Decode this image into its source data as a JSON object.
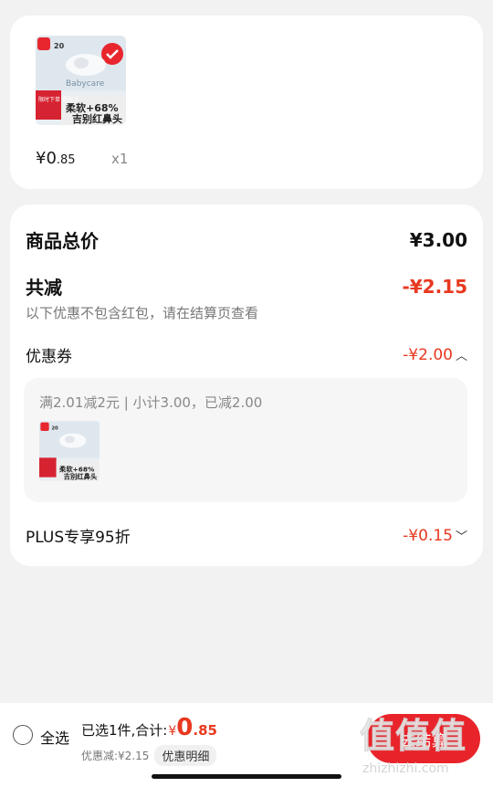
{
  "product": {
    "image_text": {
      "brand": "Babycare",
      "count": "20",
      "promo": "限时下单 送闲 3",
      "slogan_1": "柔软+68%",
      "slogan_2": "吉别红鼻头"
    },
    "price_symbol": "¥",
    "price_int": "0",
    "price_dec": ".85",
    "quantity": "x1"
  },
  "summary": {
    "total_label": "商品总价",
    "total_value": "¥3.00",
    "reduce_label": "共减",
    "reduce_value": "-¥2.15",
    "note": "以下优惠不包含红包，请在结算页查看",
    "coupon_label": "优惠券",
    "coupon_value": "-¥2.00",
    "coupon_detail": "满2.01减2元 | 小计3.00，已减2.00",
    "plus_label": "PLUS专享95折",
    "plus_value": "-¥0.15"
  },
  "bottom_bar": {
    "select_all": "全选",
    "selected_summary": "已选1件,合计:",
    "total_symbol": "¥",
    "total_int": "0",
    "total_dec": ".85",
    "discount_text": "优惠减:¥2.15",
    "detail_button": "优惠明细",
    "checkout_button": "去结算"
  },
  "watermark": {
    "text": "值值值",
    "url": "zhizhizhi.com"
  },
  "colors": {
    "accent_red": "#e8381f",
    "checkout_red": "#e8242a",
    "background": "#f2f2f2"
  }
}
